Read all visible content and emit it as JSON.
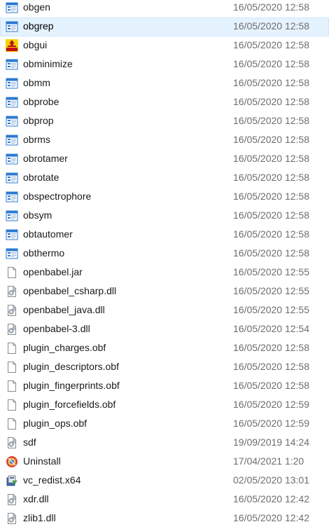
{
  "files": [
    {
      "name": "obgen",
      "date": "16/05/2020 12:58",
      "icon": "exe-window-icon"
    },
    {
      "name": "obgrep",
      "date": "16/05/2020 12:58",
      "icon": "exe-window-icon",
      "selected": true
    },
    {
      "name": "obgui",
      "date": "16/05/2020 12:58",
      "icon": "babel-app-icon"
    },
    {
      "name": "obminimize",
      "date": "16/05/2020 12:58",
      "icon": "exe-window-icon"
    },
    {
      "name": "obmm",
      "date": "16/05/2020 12:58",
      "icon": "exe-window-icon"
    },
    {
      "name": "obprobe",
      "date": "16/05/2020 12:58",
      "icon": "exe-window-icon"
    },
    {
      "name": "obprop",
      "date": "16/05/2020 12:58",
      "icon": "exe-window-icon"
    },
    {
      "name": "obrms",
      "date": "16/05/2020 12:58",
      "icon": "exe-window-icon"
    },
    {
      "name": "obrotamer",
      "date": "16/05/2020 12:58",
      "icon": "exe-window-icon"
    },
    {
      "name": "obrotate",
      "date": "16/05/2020 12:58",
      "icon": "exe-window-icon"
    },
    {
      "name": "obspectrophore",
      "date": "16/05/2020 12:58",
      "icon": "exe-window-icon"
    },
    {
      "name": "obsym",
      "date": "16/05/2020 12:58",
      "icon": "exe-window-icon"
    },
    {
      "name": "obtautomer",
      "date": "16/05/2020 12:58",
      "icon": "exe-window-icon"
    },
    {
      "name": "obthermo",
      "date": "16/05/2020 12:58",
      "icon": "exe-window-icon"
    },
    {
      "name": "openbabel.jar",
      "date": "16/05/2020 12:55",
      "icon": "blank-file-icon"
    },
    {
      "name": "openbabel_csharp.dll",
      "date": "16/05/2020 12:55",
      "icon": "dll-gear-icon"
    },
    {
      "name": "openbabel_java.dll",
      "date": "16/05/2020 12:55",
      "icon": "dll-gear-icon"
    },
    {
      "name": "openbabel-3.dll",
      "date": "16/05/2020 12:54",
      "icon": "dll-gear-icon"
    },
    {
      "name": "plugin_charges.obf",
      "date": "16/05/2020 12:58",
      "icon": "blank-file-icon"
    },
    {
      "name": "plugin_descriptors.obf",
      "date": "16/05/2020 12:58",
      "icon": "blank-file-icon"
    },
    {
      "name": "plugin_fingerprints.obf",
      "date": "16/05/2020 12:58",
      "icon": "blank-file-icon"
    },
    {
      "name": "plugin_forcefields.obf",
      "date": "16/05/2020 12:59",
      "icon": "blank-file-icon"
    },
    {
      "name": "plugin_ops.obf",
      "date": "16/05/2020 12:59",
      "icon": "blank-file-icon"
    },
    {
      "name": "sdf",
      "date": "19/09/2019 14:24",
      "icon": "dll-gear-icon"
    },
    {
      "name": "Uninstall",
      "date": "17/04/2021 1:20",
      "icon": "uninstall-icon"
    },
    {
      "name": "vc_redist.x64",
      "date": "02/05/2020 13:01",
      "icon": "installer-icon"
    },
    {
      "name": "xdr.dll",
      "date": "16/05/2020 12:42",
      "icon": "dll-gear-icon"
    },
    {
      "name": "zlib1.dll",
      "date": "16/05/2020 12:42",
      "icon": "dll-gear-icon"
    }
  ],
  "colors": {
    "selected_bg": "#e5f3ff",
    "selected_border": "#cce8ff",
    "date_text": "#6d6d6d",
    "exe_icon_blue": "#2b79d0"
  }
}
